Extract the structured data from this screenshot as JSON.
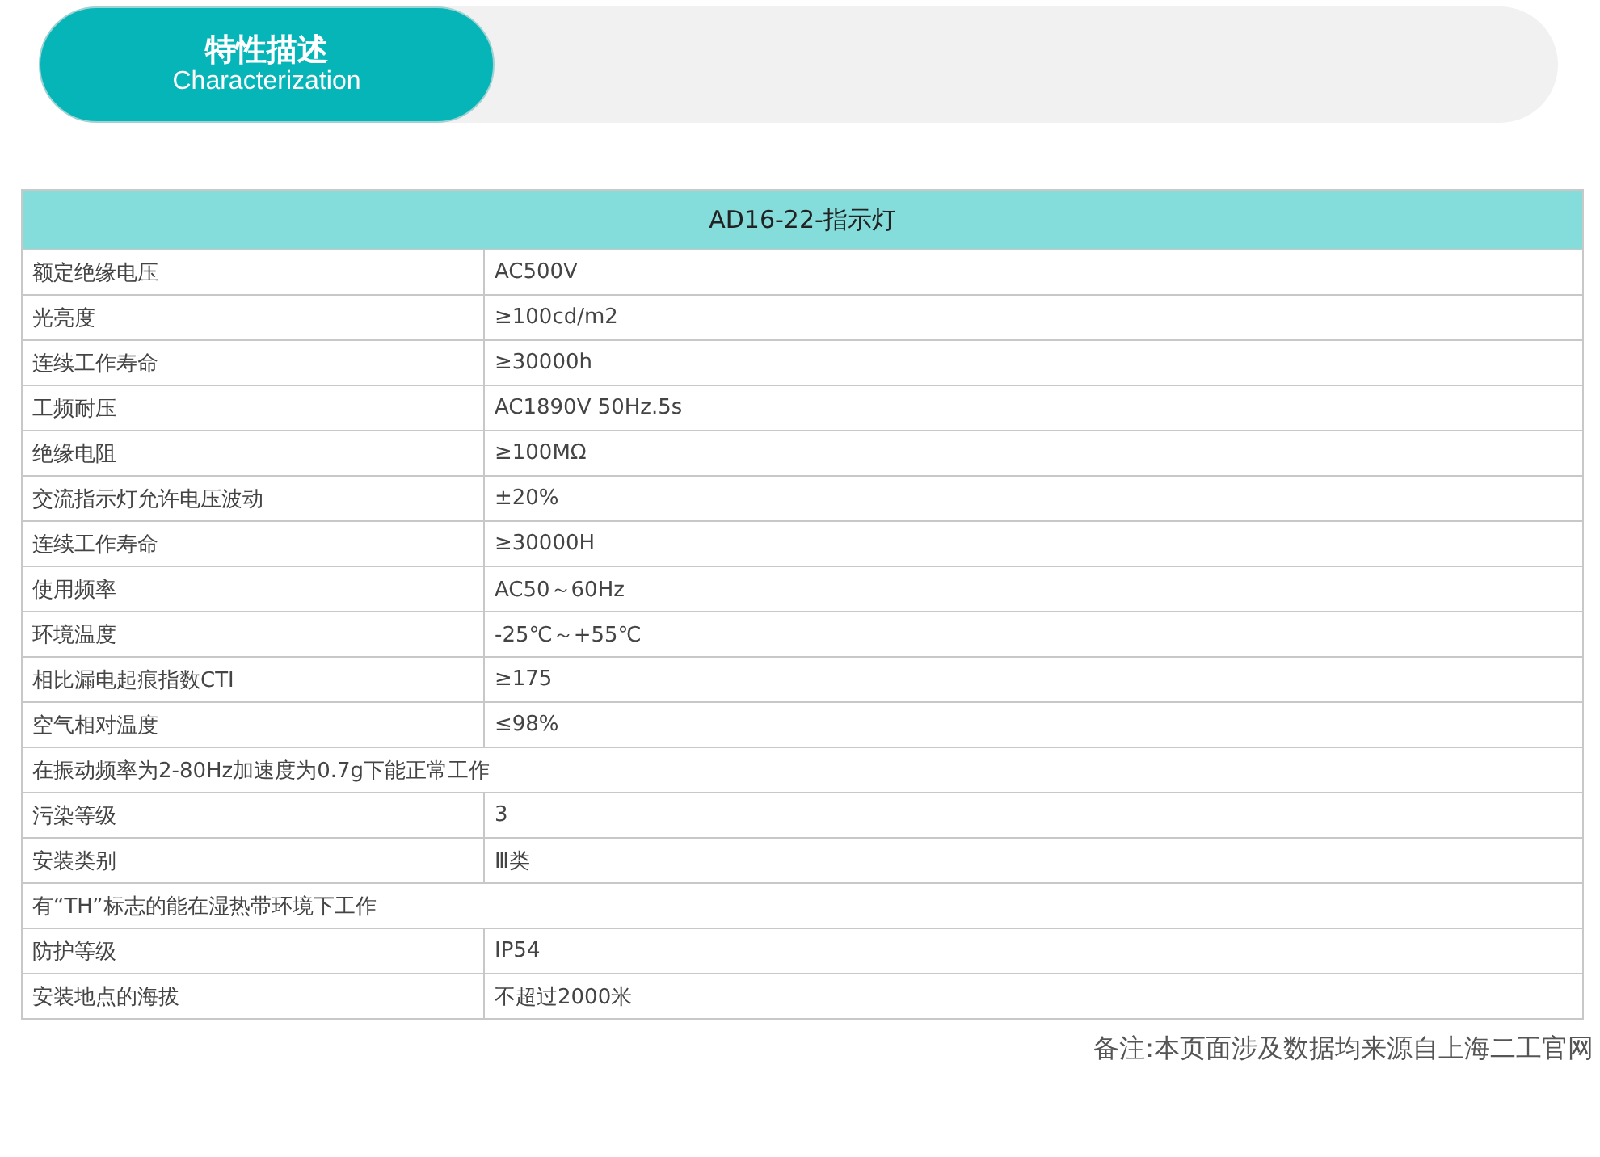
{
  "section_header": {
    "title": "特性描述",
    "subtitle": "Characterization"
  },
  "table": {
    "title": "AD16-22-指示灯",
    "rows": [
      {
        "kind": "pair",
        "label": "额定绝缘电压",
        "value": "AC500V"
      },
      {
        "kind": "pair",
        "label": "光亮度",
        "value": "≥100cd/m2"
      },
      {
        "kind": "pair",
        "label": "连续工作寿命",
        "value": "≥30000h"
      },
      {
        "kind": "pair",
        "label": "工频耐压",
        "value": "AC1890V 50Hz.5s"
      },
      {
        "kind": "pair",
        "label": "绝缘电阻",
        "value": "≥100MΩ"
      },
      {
        "kind": "pair",
        "label": "交流指示灯允许电压波动",
        "value": "±20%"
      },
      {
        "kind": "pair",
        "label": "连续工作寿命",
        "value": "≥30000H"
      },
      {
        "kind": "pair",
        "label": "使用频率",
        "value": "AC50～60Hz"
      },
      {
        "kind": "pair",
        "label": "环境温度",
        "value": "-25℃～+55℃"
      },
      {
        "kind": "pair",
        "label": "相比漏电起痕指数CTI",
        "value": "≥175"
      },
      {
        "kind": "pair",
        "label": "空气相对温度",
        "value": "≤98%"
      },
      {
        "kind": "note",
        "label": "在振动频率为2-80Hz加速度为0.7g下能正常工作"
      },
      {
        "kind": "pair",
        "label": "污染等级",
        "value": "3"
      },
      {
        "kind": "pair",
        "label": "安装类别",
        "value": "Ⅲ类"
      },
      {
        "kind": "note",
        "label": "有“TH”标志的能在湿热带环境下工作"
      },
      {
        "kind": "pair",
        "label": "防护等级",
        "value": "IP54"
      },
      {
        "kind": "pair",
        "label": "安装地点的海拔",
        "value": "不超过2000米"
      }
    ]
  },
  "footnote": "备注:本页面涉及数据均来源自上海二工官网"
}
